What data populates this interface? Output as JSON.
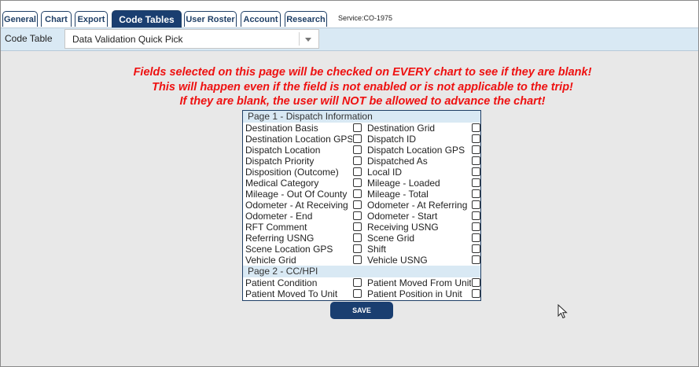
{
  "tabs": [
    "General",
    "Chart",
    "Export",
    "Code Tables",
    "User Roster",
    "Account",
    "Research"
  ],
  "active_tab": "Code Tables",
  "service": "Service:CO-1975",
  "code_table": {
    "label": "Code Table",
    "value": "Data Validation Quick Pick"
  },
  "warning": [
    "Fields selected on this page will be checked on EVERY chart to see if they are blank!",
    "This will happen even if the field is not enabled or is not applicable to the trip!",
    "If they are blank, the user will NOT be allowed to advance the chart!"
  ],
  "sections": [
    {
      "title": "Page 1 - Dispatch Information",
      "fields": [
        {
          "label": "Destination Basis",
          "checked": false
        },
        {
          "label": "Destination Grid",
          "checked": false
        },
        {
          "label": "Destination Location GPS",
          "checked": false
        },
        {
          "label": "Dispatch ID",
          "checked": false
        },
        {
          "label": "Dispatch Location",
          "checked": false
        },
        {
          "label": "Dispatch Location GPS",
          "checked": false
        },
        {
          "label": "Dispatch Priority",
          "checked": false
        },
        {
          "label": "Dispatched As",
          "checked": false
        },
        {
          "label": "Disposition (Outcome)",
          "checked": false
        },
        {
          "label": "Local ID",
          "checked": false
        },
        {
          "label": "Medical Category",
          "checked": false
        },
        {
          "label": "Mileage - Loaded",
          "checked": false
        },
        {
          "label": "Mileage - Out Of County",
          "checked": false
        },
        {
          "label": "Mileage - Total",
          "checked": false
        },
        {
          "label": "Odometer - At Receiving",
          "checked": false
        },
        {
          "label": "Odometer - At Referring",
          "checked": false
        },
        {
          "label": "Odometer - End",
          "checked": false
        },
        {
          "label": "Odometer - Start",
          "checked": false
        },
        {
          "label": "RFT Comment",
          "checked": false
        },
        {
          "label": "Receiving USNG",
          "checked": false
        },
        {
          "label": "Referring USNG",
          "checked": false
        },
        {
          "label": "Scene Grid",
          "checked": false
        },
        {
          "label": "Scene Location GPS",
          "checked": false
        },
        {
          "label": "Shift",
          "checked": false
        },
        {
          "label": "Vehicle Grid",
          "checked": false
        },
        {
          "label": "Vehicle USNG",
          "checked": false
        }
      ]
    },
    {
      "title": "Page 2 - CC/HPI",
      "fields": [
        {
          "label": "Patient Condition",
          "checked": false
        },
        {
          "label": "Patient Moved From Unit",
          "checked": false
        },
        {
          "label": "Patient Moved To Unit",
          "checked": false
        },
        {
          "label": "Patient Position in Unit",
          "checked": false
        }
      ]
    }
  ],
  "save_label": "SAVE",
  "icons": {
    "dropdown": "chevron-down-icon",
    "cursor": "mouse-pointer-icon"
  }
}
